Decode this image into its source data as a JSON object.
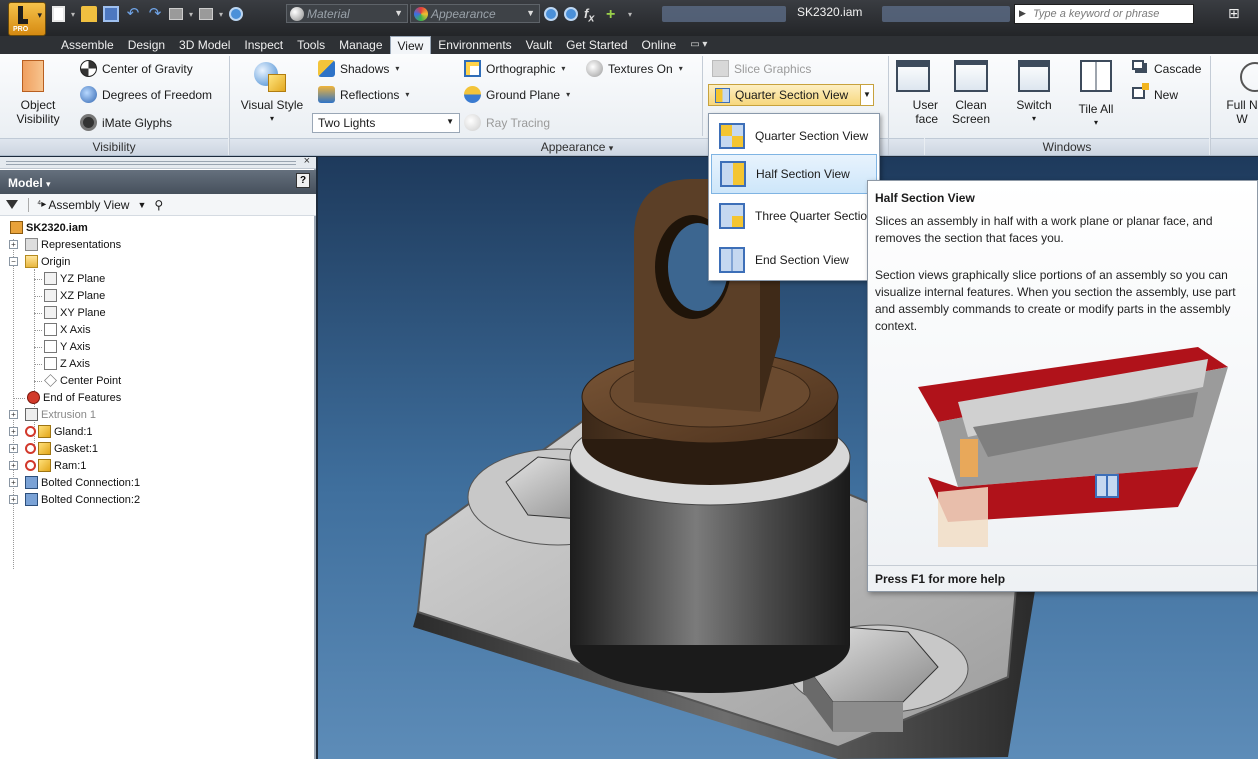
{
  "title_bar": {
    "material_placeholder": "Material",
    "appearance_placeholder": "Appearance",
    "document_title": "SK2320.iam",
    "help_search_placeholder": "Type a keyword or phrase",
    "app_badge": "PRO"
  },
  "menu_tabs": [
    {
      "label": "Assemble"
    },
    {
      "label": "Design"
    },
    {
      "label": "3D Model"
    },
    {
      "label": "Inspect"
    },
    {
      "label": "Tools"
    },
    {
      "label": "Manage"
    },
    {
      "label": "View",
      "active": true
    },
    {
      "label": "Environments"
    },
    {
      "label": "Vault"
    },
    {
      "label": "Get Started"
    },
    {
      "label": "Online"
    }
  ],
  "ribbon": {
    "visibility": {
      "panel_label": "Visibility",
      "object_visibility_line1": "Object",
      "object_visibility_line2": "Visibility",
      "center_of_gravity": "Center of Gravity",
      "degrees_of_freedom": "Degrees of Freedom",
      "imate_glyphs": "iMate Glyphs"
    },
    "appearance": {
      "panel_label": "Appearance",
      "visual_style": "Visual Style",
      "shadows": "Shadows",
      "reflections": "Reflections",
      "lighting_value": "Two Lights",
      "orthographic": "Orthographic",
      "textures": "Textures On",
      "ground_plane": "Ground Plane",
      "ray_tracing": "Ray Tracing",
      "slice_graphics": "Slice Graphics",
      "section_view": "Quarter Section View"
    },
    "windows": {
      "panel_label": "Windows",
      "user_interface_line1": "User",
      "user_interface_line2": "face",
      "clean_screen_line1": "Clean",
      "clean_screen_line2": "Screen",
      "switch": "Switch",
      "tile_all": "Tile All",
      "cascade": "Cascade",
      "new": "New"
    },
    "navigate": {
      "full_nav_line1": "Full N",
      "full_nav_line2": "W"
    }
  },
  "browser": {
    "header": "Model",
    "view_mode": "Assembly View",
    "root": "SK2320.iam",
    "nodes": {
      "representations": "Representations",
      "origin": "Origin",
      "yz_plane": "YZ Plane",
      "xz_plane": "XZ Plane",
      "xy_plane": "XY Plane",
      "x_axis": "X Axis",
      "y_axis": "Y Axis",
      "z_axis": "Z Axis",
      "center_point": "Center Point",
      "end_of_features": "End of Features",
      "extrusion": "Extrusion 1",
      "gland": "Gland:1",
      "gasket": "Gasket:1",
      "ram": "Ram:1",
      "bolted_1": "Bolted Connection:1",
      "bolted_2": "Bolted Connection:2"
    }
  },
  "section_menu": {
    "items": [
      {
        "label": "Quarter Section View"
      },
      {
        "label": "Half Section View",
        "highlighted": true
      },
      {
        "label": "Three Quarter Sectio"
      },
      {
        "label": "End Section View"
      }
    ]
  },
  "tooltip": {
    "title": "Half Section View",
    "description": "Slices an assembly in half with a work plane or planar face, and removes the section that faces you.",
    "detail": "Section views graphically slice portions of an assembly so you can visualize internal features. When you section the assembly, use part and assembly commands to create or modify parts in the assembly context.",
    "footer": "Press F1 for more help"
  },
  "colors": {
    "viewport_top": "#1e3a5c",
    "viewport_bottom": "#5d8cb8",
    "highlight": "#cde6fa",
    "accent": "#f7d77d"
  }
}
